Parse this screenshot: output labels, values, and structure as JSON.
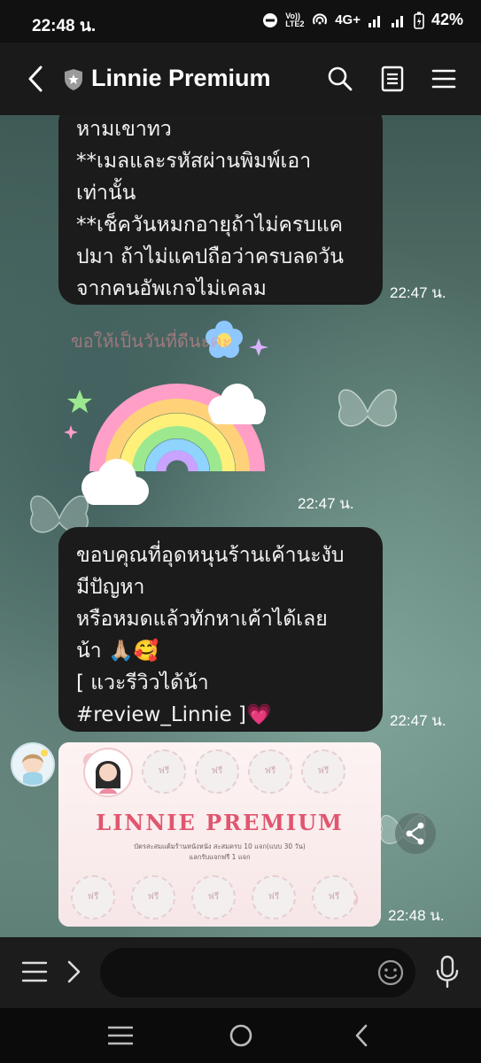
{
  "status_bar": {
    "time": "22:48 น.",
    "network": "4G+",
    "volte": "Vo)) LTE2",
    "battery": "42%"
  },
  "header": {
    "title": "Linnie Premium"
  },
  "messages": [
    {
      "lines": [
        "หามเขาทว",
        "**เมลและรหัสผ่านพิมพ์เอา",
        "เท่านั้น",
        "**เช็ควันหมกอายุถ้าไม่ครบแค",
        "ปมา ถ้าไม่แคปถือว่าครบลดวัน",
        "จากคนอัพเกจไม่เคลม"
      ],
      "time": "22:47 น."
    },
    {
      "sticker_text": "ขอให้เป็นวันที่ดีนะคะ",
      "time": "22:47 น."
    },
    {
      "lines": [
        "ขอบคุณที่อุดหนุนร้านเค้านะงับ",
        "มีปัญหา",
        "หรือหมดแล้วทักหาเค้าได้เลย",
        "น้า 🙏🏼🥰",
        "[ แวะรีวิวได้น้า",
        "#review_Linnie ]💗"
      ],
      "time": "22:47 น."
    },
    {
      "card_title": "LINNIE PREMIUM",
      "card_subtitle": "บัตรสะสมแต้มร้านหนังหนัง สะสมครบ 10 แจก(แบบ 30 วัน)",
      "card_subtitle2": "แลกรับแจกฟรี 1 แจก",
      "stamp_label": "ฟรี",
      "time": "22:48 น."
    }
  ],
  "colors": {
    "bubble_bg": "#1b1b1b",
    "header_bg": "#1a1a1a",
    "card_pink": "#e0566f"
  }
}
